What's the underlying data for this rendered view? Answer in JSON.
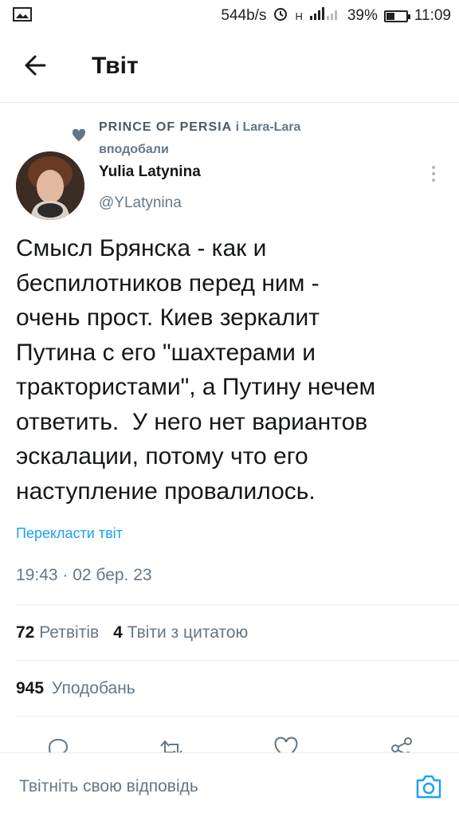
{
  "status_bar": {
    "speed": "544b/s",
    "net": "H",
    "battery_pct": "39%",
    "time": "11:09",
    "battery_level": 0.39
  },
  "header": {
    "title": "Твіт"
  },
  "liked_by": {
    "name_styled": "PRINCE OF PERSIA",
    "rest": " і Lara-Lara",
    "action": "вподобали"
  },
  "author": {
    "name": "Yulia Latynina",
    "handle": "@YLatynina"
  },
  "tweet": {
    "text": "Смысл Брянска - как и\nбеспилотников перед ним -\nочень прост. Киев зеркалит\nПутина с его \"шахтерами и\nтрактористами\", а Путину нечем\nответить.  У него нет вариантов\nэскалации, потому что его\nнаступление провалилось.",
    "translate": "Перекласти твіт",
    "timestamp": "19:43 · 02 бер. 23"
  },
  "stats": {
    "retweets_count": "72",
    "retweets_label": "Ретвітів",
    "quotes_count": "4",
    "quotes_label": "Твіти з цитатою",
    "likes_count": "945",
    "likes_label": "Уподобань"
  },
  "reply": {
    "placeholder": "Твітніть свою відповідь"
  },
  "colors": {
    "accent": "#1da1f2",
    "secondary_text": "#657786",
    "divider": "#e6ecf0"
  },
  "icons": [
    "back-arrow-icon",
    "heart-icon",
    "more-icon",
    "reply-icon",
    "retweet-icon",
    "like-icon",
    "share-icon",
    "camera-icon"
  ]
}
